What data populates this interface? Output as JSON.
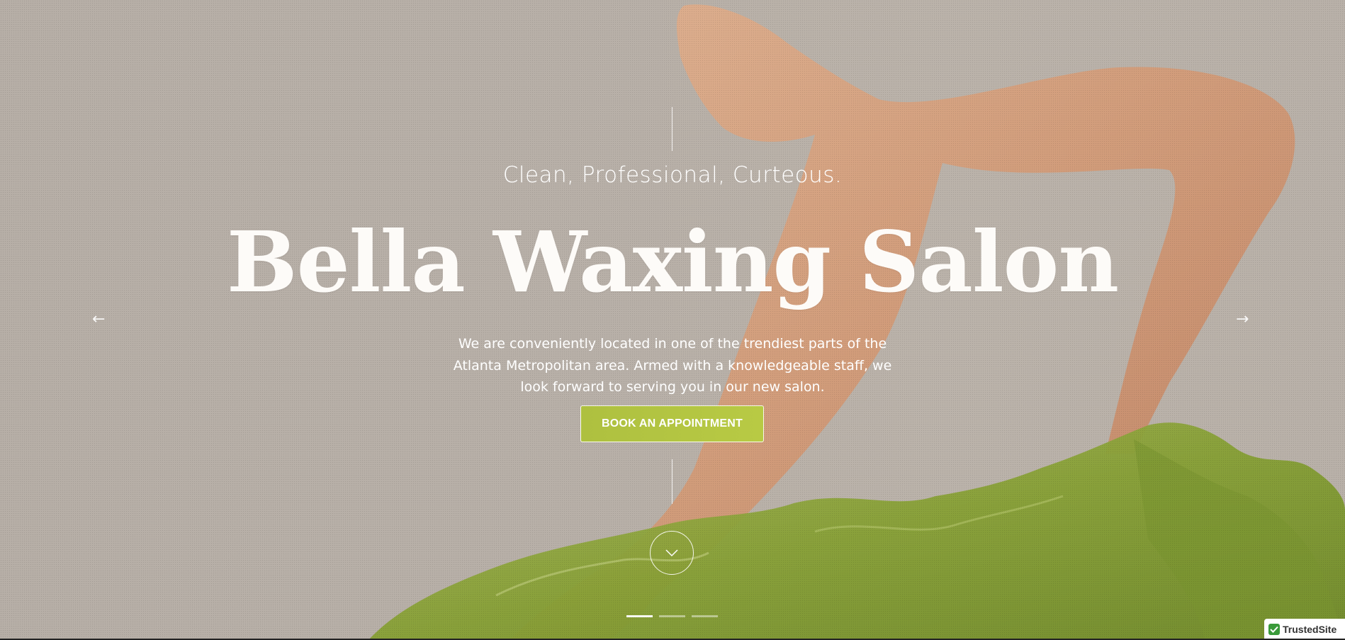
{
  "hero": {
    "tagline": "Clean, Professional, Curteous.",
    "title": "Bella Waxing Salon",
    "description": "We are conveniently located in one of the trendiest parts of the Atlanta Metropolitan area. Armed with a knowledgeable staff, we look forward to serving you in our new salon.",
    "cta_label": "BOOK AN APPOINTMENT",
    "prev_arrow": "←",
    "next_arrow": "→"
  },
  "slider": {
    "slide_count": 3,
    "active_index": 0
  },
  "badge": {
    "label": "TrustedSite",
    "icon": "check-icon"
  },
  "colors": {
    "background": "#b8b0a8",
    "accent": "#b3c542",
    "text": "#ffffff",
    "fabric": "#8ea43a",
    "skin": "#d39a76"
  }
}
